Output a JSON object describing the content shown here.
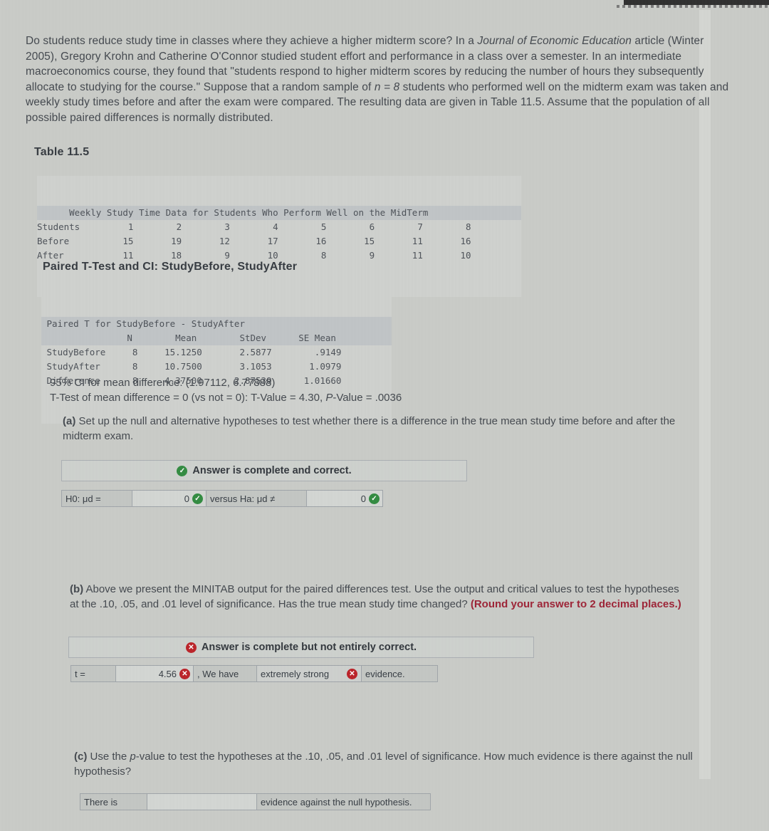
{
  "intro": {
    "p1_a": "Do students reduce study time in classes where they achieve a higher midterm score? In a ",
    "p1_italic": "Journal of Economic Education",
    "p1_b": " article (Winter 2005), Gregory Krohn and Catherine O'Connor studied student effort and performance in a class over a semester. In an intermediate macroeconomics course, they found that \"students respond to higher midterm scores by reducing the number of hours they subsequently allocate to studying for the course.\" Suppose that a random sample of ",
    "p1_n": "n = 8",
    "p1_c": " students who performed well on the midterm exam was taken and weekly study times before and after the exam were compared. The resulting data are given in Table 11.5. Assume that the population of all possible paired differences is normally distributed."
  },
  "table_caption": "Table 11.5",
  "table115": {
    "title": "      Weekly Study Time Data for Students Who Perform Well on the MidTerm ",
    "rows": [
      "Students         1        2        3        4        5        6        7        8",
      "Before          15       19       12       17       16       15       11       16",
      "After           11       18        9       10        8        9       11       10"
    ]
  },
  "minitab": {
    "heading": "Paired T-Test and CI: StudyBefore, StudyAfter",
    "title": " Paired T for StudyBefore - StudyAfter",
    "header": "                N        Mean        StDev      SE Mean",
    "rows": [
      " StudyBefore     8     15.1250       2.5877        .9149",
      " StudyAfter      8     10.7500       3.1053       1.0979",
      " Difference      8     4.37500      2.87539      1.01660"
    ],
    "ci_line": "95% CI for mean difference: (1.97112, 6.77888)",
    "ttest_line_a": "T-Test of mean difference = 0 (vs not = 0): T-Value = 4.30, ",
    "ttest_line_p": "P",
    "ttest_line_b": "-Value = .0036"
  },
  "part_a": {
    "label": "(a)",
    "text": " Set up the null and alternative hypotheses to test whether there is a difference in the true mean study time before and after the midterm exam.",
    "banner": "Answer is complete and correct.",
    "banner_icon": "check-circle-icon",
    "h0_label": "H0: μd =",
    "h0_value": "0",
    "versus_label": "versus Ha: μd ≠",
    "ha_value": "0"
  },
  "part_b": {
    "label": "(b)",
    "text_a": " Above we present the MINITAB output for the paired differences test. Use the output and critical values to test the hypotheses at the .10, .05, and .01 level of significance. Has the true mean study time changed? ",
    "text_red": "(Round your answer to 2 decimal places.)",
    "banner": "Answer is complete but not entirely correct.",
    "banner_icon": "x-circle-icon",
    "t_label": "t =",
    "t_value": "4.56",
    "we_have": ", We have",
    "strength_value": "extremely strong",
    "evidence_label": "evidence."
  },
  "part_c": {
    "label": "(c)",
    "text_a": " Use the ",
    "text_italic": "p",
    "text_b": "-value to test the hypotheses at the .10, .05, and .01 level of significance. How much evidence is there against the null hypothesis?",
    "there_is": "There is",
    "blank_value": "",
    "evidence_label": "evidence against the null hypothesis."
  },
  "chrome": {
    "scroll_up_icon": "caret-up-icon"
  }
}
